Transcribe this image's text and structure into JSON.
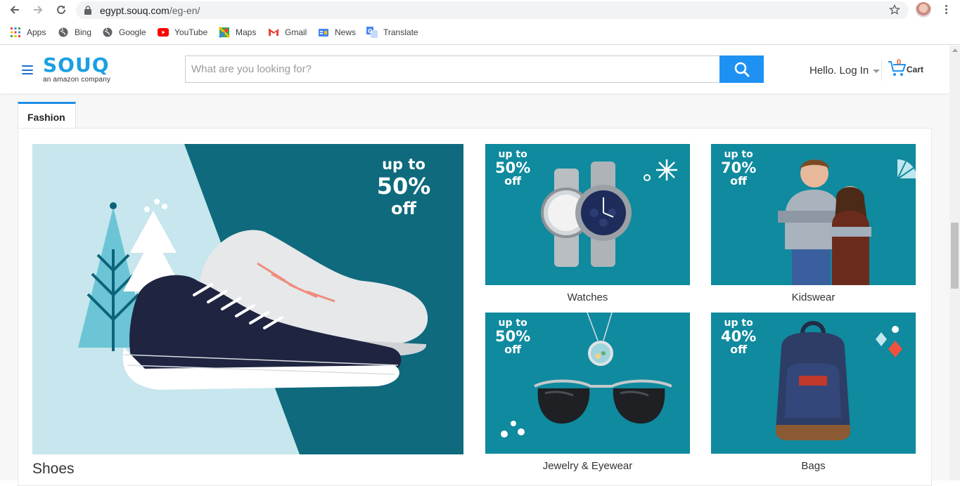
{
  "browser": {
    "url_host": "egypt.souq.com",
    "url_path": "/eg-en/",
    "bookmarks": [
      "Apps",
      "Bing",
      "Google",
      "YouTube",
      "Maps",
      "Gmail",
      "News",
      "Translate"
    ]
  },
  "header": {
    "logo_text": "SOUQ",
    "logo_tagline": "an amazon company",
    "search_placeholder": "What are you looking for?",
    "login_label": "Hello. Log In",
    "cart_count": "0",
    "cart_label": "Cart"
  },
  "section": {
    "tab_label": "Fashion",
    "hero": {
      "promo_top": "up to",
      "promo_value": "50%",
      "promo_bottom": "off",
      "caption": "Shoes"
    },
    "tiles": [
      {
        "promo_top": "up to",
        "promo_value": "50%",
        "promo_bottom": "off",
        "caption": "Watches"
      },
      {
        "promo_top": "up to",
        "promo_value": "70%",
        "promo_bottom": "off",
        "caption": "Kidswear"
      },
      {
        "promo_top": "up to",
        "promo_value": "50%",
        "promo_bottom": "off",
        "caption": "Jewelry & Eyewear"
      },
      {
        "promo_top": "up to",
        "promo_value": "40%",
        "promo_bottom": "off",
        "caption": "Bags"
      }
    ]
  },
  "colors": {
    "brand": "#1ba0e1",
    "search_button": "#1e92f3",
    "tile_bg": "#0f8a9e",
    "hero_bg": "#0e6a7c",
    "tab_accent": "#1b8fe8"
  }
}
